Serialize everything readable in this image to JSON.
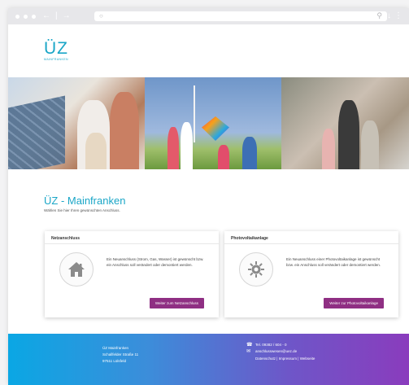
{
  "browser": {
    "nav_back": "←",
    "nav_separator": "|",
    "nav_forward": "→"
  },
  "logo": {
    "mark": "ÜZ",
    "sub": "MAINFRANKEN"
  },
  "header": {
    "title": "ÜZ - Mainfranken",
    "subtitle": "Wählen Sie hier Ihren gewünschten Anschluss."
  },
  "cards": [
    {
      "title": "Netzanschluss",
      "icon": "house-icon",
      "text": "Ein Neuanschluss (Strom, Gas, Wasser) ist gewünscht bzw. ein Anschluss soll verändert oder demontiert werden.",
      "button": "Weiter zum Netzanschluss"
    },
    {
      "title": "Photovoltaikanlage",
      "icon": "sun-gear-icon",
      "text": "Ein Neuanschluss einer Photovoltaikanlage ist gewünscht bzw. ein Anschluss soll verändert oder demontiert werden.",
      "button": "Weiter zur Photovoltaikanlage"
    }
  ],
  "footer": {
    "address": [
      "ÜZ Mainfranken",
      "Schallfelder Straße 11",
      "97511 Lülsfeld"
    ],
    "phone": "Tel. 09382 / 604 - 0",
    "email": "anschlusswesen@uez.de",
    "links": [
      "Datenschutz",
      "Impressum",
      "Webseite"
    ],
    "link_separator": "|"
  },
  "colors": {
    "accent": "#1aa6c7",
    "button": "#8f2f83",
    "footer_start": "#0aa7e4",
    "footer_end": "#8a3cbd"
  }
}
